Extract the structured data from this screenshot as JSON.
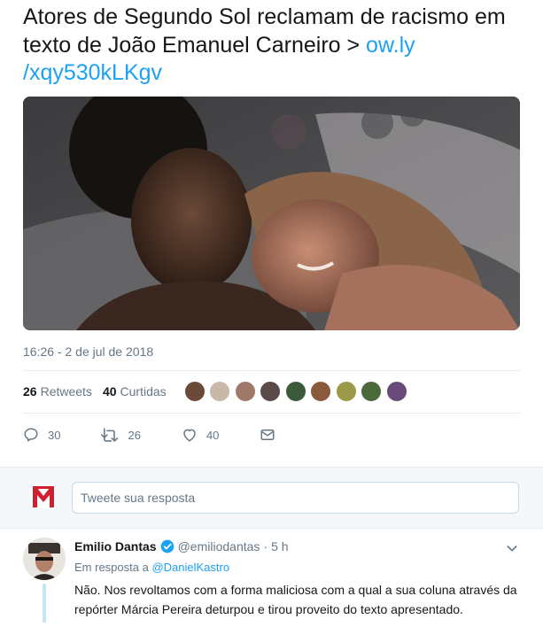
{
  "tweet": {
    "text": "Atores de Segundo Sol reclamam de racismo em texto de João Emanuel Carneiro > ",
    "link_line1": "ow.ly",
    "link_line2": "/xqy530kLKgv",
    "timestamp": "16:26 - 2 de jul de 2018",
    "stats": {
      "retweets_count": "26",
      "retweets_label": "Retweets",
      "likes_count": "40",
      "likes_label": "Curtidas"
    },
    "liker_avatar_colors": [
      "#6b4a3a",
      "#c9b8a8",
      "#a0786a",
      "#5a4a48",
      "#3a5a3a",
      "#8a5a3a",
      "#9a9a4a",
      "#4a6a3a",
      "#6a4a7a"
    ],
    "actions": {
      "replies": "30",
      "retweets": "26",
      "likes": "40"
    }
  },
  "reply_box": {
    "placeholder": "Tweete sua resposta",
    "brand_color": "#d0202f"
  },
  "reply": {
    "name": "Emilio Dantas",
    "handle": "@emiliodantas",
    "dot": "·",
    "time": "5 h",
    "in_reply_prefix": "Em resposta a ",
    "in_reply_mention": "@DanielKastro",
    "text": "Não. Nos revoltamos com a forma maliciosa com a qual a sua coluna através da repórter Márcia Pereira deturpou e tirou proveito do texto apresentado."
  },
  "colors": {
    "link": "#1da1f2",
    "muted": "#657786",
    "text": "#14171a"
  }
}
